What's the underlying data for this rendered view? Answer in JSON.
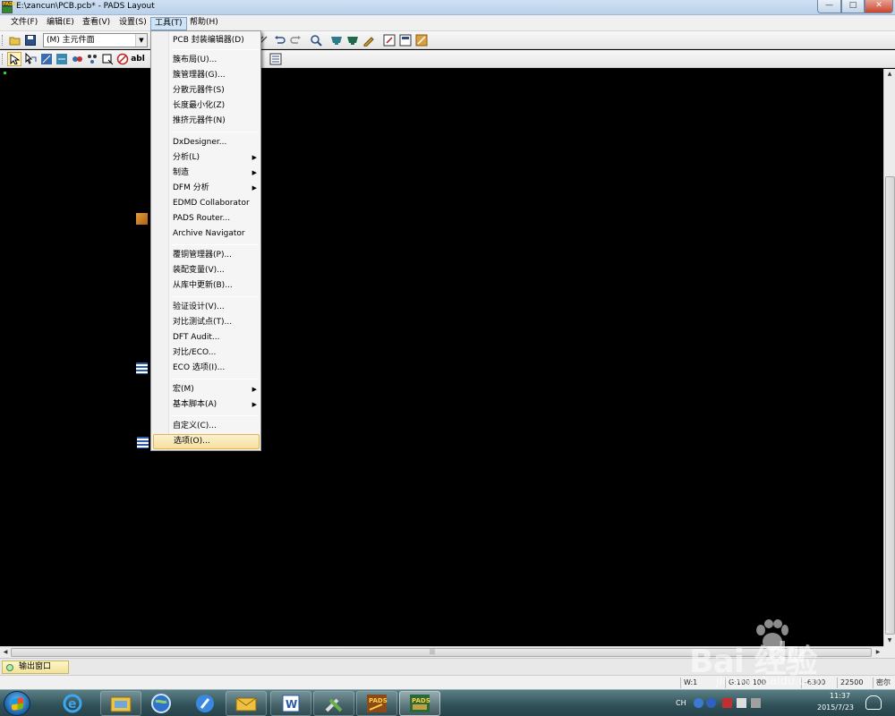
{
  "window": {
    "title": "E:\\zancun\\PCB.pcb* - PADS Layout",
    "app_icon_text": "PADS",
    "controls": {
      "minimize": "—",
      "maximize": "□",
      "close": "✕"
    }
  },
  "menubar": {
    "items": [
      "文件(F)",
      "编辑(E)",
      "查看(V)",
      "设置(S)",
      "工具(T)",
      "帮助(H)"
    ],
    "active_index": 4
  },
  "toolbar1": {
    "layer_select_value": "(M) 主元件面",
    "icons": [
      "open-icon",
      "save-icon",
      "undo-icon",
      "redo-icon",
      "zoom-icon",
      "display-icon",
      "filter-icon",
      "sketch-icon",
      "hyperlink-icon",
      "library-icon",
      "router-icon"
    ]
  },
  "toolbar2": {
    "icons": [
      "select-icon",
      "design-icon",
      "drafting-icon",
      "dimension-icon",
      "ecotool-icon",
      "bga-icon",
      "layout-icon",
      "drc-icon",
      "text-icon",
      "options-icon"
    ],
    "text_tool": "abl"
  },
  "tools_menu": {
    "items": [
      {
        "label": "PCB 封装编辑器(D)",
        "submenu": false
      },
      {
        "label": "簇布局(U)...",
        "submenu": false
      },
      {
        "label": "簇管理器(G)...",
        "submenu": false
      },
      {
        "label": "分散元器件(S)",
        "submenu": false
      },
      {
        "label": "长度最小化(Z)",
        "submenu": false
      },
      {
        "label": "推挤元器件(N)",
        "submenu": false
      },
      {
        "label": "DxDesigner...",
        "submenu": false
      },
      {
        "label": "分析(L)",
        "submenu": true
      },
      {
        "label": "制造",
        "submenu": true
      },
      {
        "label": "DFM 分析",
        "submenu": true
      },
      {
        "label": "EDMD Collaborator",
        "submenu": false
      },
      {
        "label": "PADS Router...",
        "submenu": false
      },
      {
        "label": "Archive Navigator",
        "submenu": false
      },
      {
        "label": "覆铜管理器(P)...",
        "submenu": false
      },
      {
        "label": "装配变量(V)...",
        "submenu": false
      },
      {
        "label": "从库中更新(B)...",
        "submenu": false
      },
      {
        "label": "验证设计(V)...",
        "submenu": false
      },
      {
        "label": "对比测试点(T)...",
        "submenu": false
      },
      {
        "label": "DFT Audit...",
        "submenu": false
      },
      {
        "label": "对比/ECO...",
        "submenu": false
      },
      {
        "label": "ECO 选项(I)...",
        "submenu": false
      },
      {
        "label": "宏(M)",
        "submenu": true
      },
      {
        "label": "基本脚本(A)",
        "submenu": true
      },
      {
        "label": "自定义(C)...",
        "submenu": false
      },
      {
        "label": "选项(O)...",
        "submenu": false
      }
    ],
    "highlighted": "选项(O)...",
    "submenu_arrow": "▶"
  },
  "output_window": {
    "tab_label": "输出窗口"
  },
  "statusbar": {
    "width": "W:1",
    "grid": "G:100 100",
    "x": "-6300",
    "y": "22500",
    "units": "密尔"
  },
  "taskbar": {
    "time": "11:37",
    "date": "2015/7/23",
    "lang": "CH",
    "pads_label": "PADS"
  },
  "watermark": {
    "main": "Bai  经验",
    "du": "du",
    "sub": "jingyan.baidu.com"
  },
  "colors": {
    "canvas": "#000000",
    "menu_highlight": "#f6dfa0",
    "origin": "#2cd02c"
  }
}
